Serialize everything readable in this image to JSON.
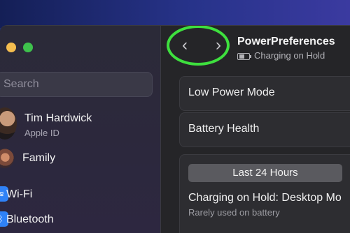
{
  "sidebar": {
    "search_placeholder": "Search",
    "profile": {
      "name": "Tim Hardwick",
      "subtitle": "Apple ID"
    },
    "family_label": "Family",
    "items": [
      {
        "label": "Wi-Fi",
        "icon": "wifi-icon"
      },
      {
        "label": "Bluetooth",
        "icon": "bluetooth-icon"
      }
    ]
  },
  "toolbar": {
    "back_glyph": "‹",
    "forward_glyph": "›",
    "title": "PowerPreferences",
    "status": "Charging on Hold",
    "status_icon": "battery-icon",
    "highlight_color": "#3ee03e"
  },
  "settings": {
    "low_power_label": "Low Power Mode",
    "battery_health_label": "Battery Health"
  },
  "usage_panel": {
    "period_label": "Last 24 Hours",
    "title": "Charging on Hold: Desktop Mo",
    "subtitle": "Rarely used on battery"
  },
  "colors": {
    "accent_blue": "#2f82f7",
    "traffic_yellow": "#f4bd4f",
    "traffic_green": "#3ec14c"
  }
}
